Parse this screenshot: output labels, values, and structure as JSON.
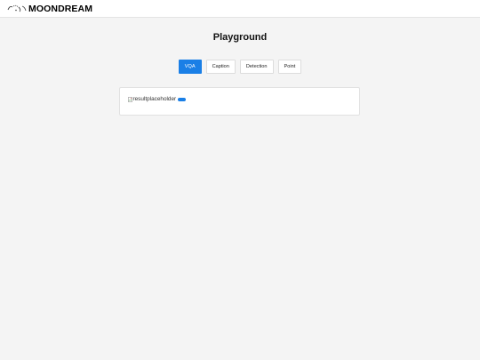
{
  "header": {
    "logo_icon": "moondream-logo-icon",
    "logo_text": "MOONDREAM"
  },
  "main": {
    "title": "Playground",
    "tabs": [
      {
        "label": "VQA",
        "active": true
      },
      {
        "label": "Caption",
        "active": false
      },
      {
        "label": "Detection",
        "active": false
      },
      {
        "label": "Point",
        "active": false
      }
    ],
    "result": {
      "image_alt": "resultplaceholder",
      "broken_image_icon": "broken-image-icon"
    }
  },
  "colors": {
    "accent": "#1a7fe6",
    "background": "#f4f4f4",
    "card": "#ffffff"
  }
}
